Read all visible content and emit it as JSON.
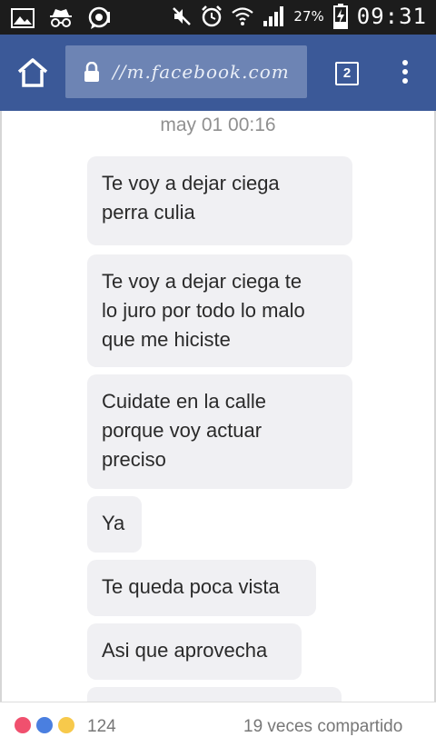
{
  "statusbar": {
    "battery": "27%",
    "time": "09:31"
  },
  "browser": {
    "url": "//m.facebook.com",
    "tab_count": "2"
  },
  "chat": {
    "timestamp": "may 01 00:16",
    "messages": [
      {
        "line1": "Te voy a dejar ciega",
        "line2": "perra culia",
        "line3": ""
      },
      {
        "line1": "Te voy a dejar ciega te",
        "line2": "lo juro por todo lo malo",
        "line3": "que me hiciste"
      },
      {
        "line1": "Cuidate en la calle",
        "line2": "porque voy actuar",
        "line3": "preciso"
      },
      {
        "line1": "Ya",
        "line2": "",
        "line3": ""
      },
      {
        "line1": "Te queda poca vista",
        "line2": "",
        "line3": ""
      },
      {
        "line1": "Asi que aprovecha",
        "line2": "",
        "line3": ""
      }
    ]
  },
  "footer": {
    "reaction_count": "124",
    "shares": "19 veces compartido"
  },
  "colors": {
    "facebook_blue": "#3b5998",
    "bubble": "#f0f0f3"
  }
}
